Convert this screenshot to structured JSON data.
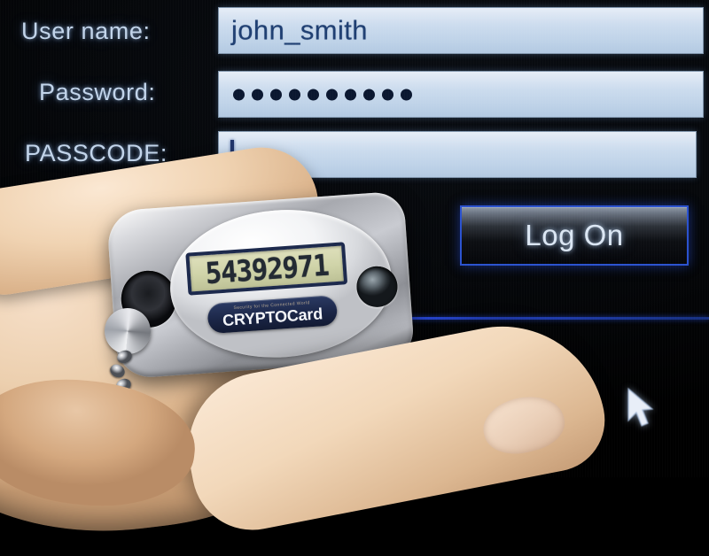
{
  "screen": {
    "form": {
      "fields": [
        {
          "label": "User name:",
          "value": "john_smith",
          "type": "text",
          "masked": false
        },
        {
          "label": "Password:",
          "value": "",
          "type": "password",
          "masked": true,
          "mask_dot_count": 10
        },
        {
          "label": "PASSCODE:",
          "value": "",
          "type": "text",
          "masked": false,
          "focused": true,
          "placeholder": ""
        }
      ],
      "submit_label": "Log On"
    },
    "cursor_icon": "arrow-pointer-icon",
    "divider_color": "#2746d6",
    "background_color": "#000000",
    "label_color": "#c2d4ea",
    "field_background_color": "#c6d8ec",
    "field_text_color": "#1f3f72",
    "button_border_color": "#2b52cf"
  },
  "token": {
    "display_value": "54392971",
    "brand": "CRYPTOCard",
    "brand_tagline": "Security for the Connected World",
    "brand_logo_part1": "CRYPTO",
    "brand_logo_part2": "Card",
    "button_icon": "token-press-button-icon",
    "keyring_icon": "split-ring-icon",
    "chain_icon": "bead-chain-icon",
    "body_color": "#b9bbc1",
    "lcd_background_color": "#cfd3a8",
    "lcd_text_color": "#232a33",
    "badge_color": "#1b2647"
  },
  "hand": {
    "description": "hand-holding-token"
  }
}
